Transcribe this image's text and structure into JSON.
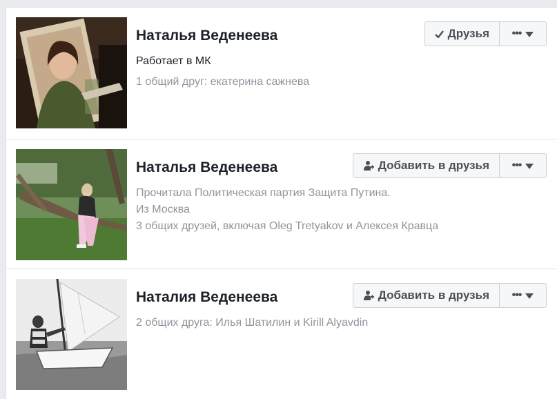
{
  "people": [
    {
      "name": "Наталья Веденеева",
      "details": [
        "Работает в МК"
      ],
      "mutual": "1 общий друг: екатерина сажнева",
      "button_label": "Друзья",
      "button_icon": "check-icon",
      "photo": "woman-with-portrait-photo"
    },
    {
      "name": "Наталья Веденеева",
      "details": [
        "Прочитала Политическая партия Защита Путина.",
        "Из Москва"
      ],
      "mutual": "3 общих друзей, включая Oleg Tretyakov и Алексея Кравца",
      "button_label": "Добавить в друзья",
      "button_icon": "add-friend-icon",
      "photo": "woman-sitting-on-tree-photo"
    },
    {
      "name": "Наталия Веденеева",
      "details": [],
      "mutual": "2 общих друга: Илья Шатилин и Kirill Alyavdin",
      "button_label": "Добавить в друзья",
      "button_icon": "add-friend-icon",
      "photo": "sailing-boat-photo"
    }
  ],
  "colors": {
    "background": "#e9ebee",
    "card": "#ffffff",
    "name_text": "#1d2129",
    "muted_text": "#90949c",
    "button_bg": "#f6f7f9",
    "button_border": "#ced0d4"
  }
}
